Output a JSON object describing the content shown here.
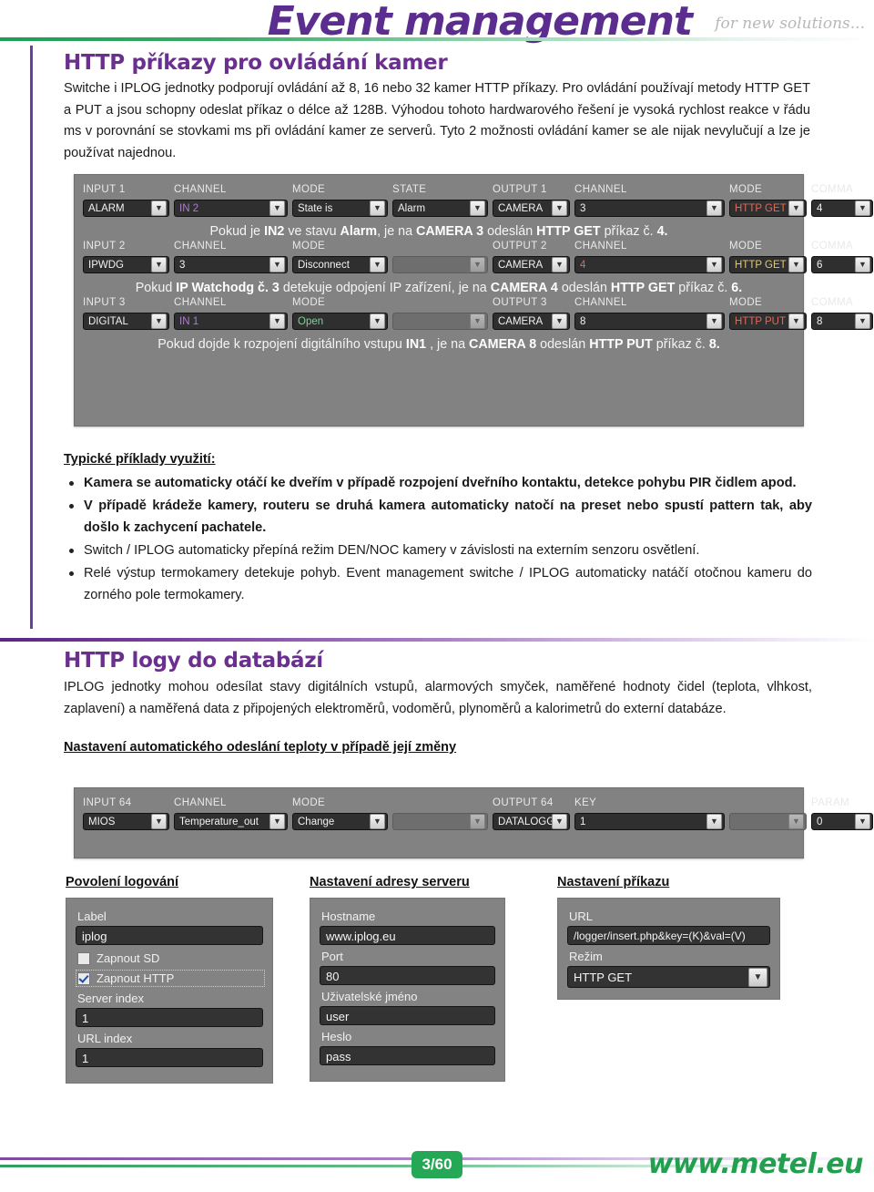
{
  "header": {
    "title": "Event management",
    "tagline": "for new solutions..."
  },
  "section1": {
    "heading": "HTTP příkazy pro ovládání kamer",
    "paragraph": "Switche i IPLOG jednotky podporují ovládání až 8, 16 nebo 32 kamer HTTP příkazy. Pro ovládání používají metody HTTP GET a PUT a jsou schopny odeslat příkaz o délce až 128B. Výhodou tohoto hardwarového řešení je vysoká rychlost reakce v řádu ms v porovnání se stovkami ms při ovládání kamer ze serverů. Tyto 2 možnosti ovládání kamer se ale nijak nevylučují a lze je používat najednou."
  },
  "config_panel": {
    "rows": [
      {
        "labels": [
          "INPUT 1",
          "CHANNEL",
          "MODE",
          "STATE",
          "OUTPUT 1",
          "CHANNEL",
          "MODE",
          "COMMA"
        ],
        "values": [
          "ALARM",
          "IN 2",
          "State is",
          "Alarm",
          "CAMERA",
          "3",
          "HTTP GET CMD",
          "4"
        ],
        "value_colors": [
          "#f2f2f2",
          "#b07ad6",
          "#f2f2f2",
          "#f2f2f2",
          "#f2f2f2",
          "#f2f2f2",
          "#e06a5a",
          "#f2f2f2"
        ],
        "caption_parts": [
          {
            "t": "Pokud je ",
            "b": false
          },
          {
            "t": "IN2",
            "b": true
          },
          {
            "t": " ve stavu ",
            "b": false
          },
          {
            "t": "Alarm",
            "b": true
          },
          {
            "t": ", je na ",
            "b": false
          },
          {
            "t": "CAMERA 3",
            "b": true
          },
          {
            "t": " odeslán ",
            "b": false
          },
          {
            "t": "HTTP GET",
            "b": true
          },
          {
            "t": " příkaz č. ",
            "b": false
          },
          {
            "t": "4.",
            "b": true
          }
        ]
      },
      {
        "labels": [
          "INPUT 2",
          "CHANNEL",
          "MODE",
          "",
          "OUTPUT 2",
          "CHANNEL",
          "MODE",
          "COMMA"
        ],
        "values": [
          "IPWDG",
          "3",
          "Disconnect",
          "",
          "CAMERA",
          "4",
          "HTTP GET CMD",
          "6"
        ],
        "value_colors": [
          "#f2f2f2",
          "#f2f2f2",
          "#f2f2f2",
          "#f2f2f2",
          "#f2f2f2",
          "#e06a5a",
          "#e0c878",
          "#f2f2f2"
        ],
        "caption_parts": [
          {
            "t": "Pokud ",
            "b": false
          },
          {
            "t": "IP Watchodg č. 3",
            "b": true
          },
          {
            "t": " detekuje odpojení IP zařízení, je na ",
            "b": false
          },
          {
            "t": "CAMERA 4",
            "b": true
          },
          {
            "t": " odeslán ",
            "b": false
          },
          {
            "t": "HTTP GET",
            "b": true
          },
          {
            "t": " příkaz č. ",
            "b": false
          },
          {
            "t": "6.",
            "b": true
          }
        ]
      },
      {
        "labels": [
          "INPUT 3",
          "CHANNEL",
          "MODE",
          "",
          "OUTPUT 3",
          "CHANNEL",
          "MODE",
          "COMMA"
        ],
        "values": [
          "DIGITAL",
          "IN 1",
          "Open",
          "",
          "CAMERA",
          "8",
          "HTTP PUT CMD",
          "8"
        ],
        "value_colors": [
          "#f2f2f2",
          "#b07ad6",
          "#7fcf9b",
          "#f2f2f2",
          "#f2f2f2",
          "#f2f2f2",
          "#e06a5a",
          "#f2f2f2"
        ],
        "caption_parts": [
          {
            "t": "Pokud dojde k rozpojení digitálního vstupu ",
            "b": false
          },
          {
            "t": "IN1",
            "b": true
          },
          {
            "t": " , je na ",
            "b": false
          },
          {
            "t": "CAMERA 8",
            "b": true
          },
          {
            "t": " odeslán ",
            "b": false
          },
          {
            "t": "HTTP PUT",
            "b": true
          },
          {
            "t": " příkaz č. ",
            "b": false
          },
          {
            "t": "8.",
            "b": true
          }
        ]
      }
    ]
  },
  "examples": {
    "heading": "Typické příklady využití:",
    "items": [
      "Kamera se automaticky otáčí ke dveřím v případě rozpojení dveřního kontaktu, detekce pohybu PIR čidlem apod.",
      "V případě krádeže kamery, routeru se druhá kamera automaticky natočí na preset nebo spustí pattern tak, aby došlo k zachycení pachatele.",
      "Switch / IPLOG automaticky přepíná režim DEN/NOC kamery v závislosti na externím senzoru osvětlení.",
      "Relé výstup termokamery detekuje pohyb. Event management switche / IPLOG automaticky natáčí otočnou kameru do zorného pole termokamery."
    ]
  },
  "section2": {
    "heading": "HTTP logy do databází",
    "paragraph": "IPLOG jednotky mohou odesílat stavy digitálních vstupů, alarmových smyček, naměřené hodnoty čidel (teplota, vlhkost, zaplavení) a naměřená data z připojených elektroměrů, vodoměrů, plynoměrů a kalorimetrů do externí databáze.",
    "subheading": "Nastavení automatického odeslání teploty v případě její změny"
  },
  "mios_panel": {
    "labels": [
      "INPUT 64",
      "CHANNEL",
      "MODE",
      "",
      "OUTPUT 64",
      "KEY",
      "",
      "PARAM"
    ],
    "values": [
      "MIOS",
      "Temperature_out",
      "Change",
      "",
      "DATALOGGER",
      "1",
      "",
      "0"
    ]
  },
  "forms": {
    "logging": {
      "title": "Povolení logování",
      "label_label": "Label",
      "label_value": "iplog",
      "sd_checkbox_label": "Zapnout SD",
      "sd_checked": false,
      "http_checkbox_label": "Zapnout HTTP",
      "http_checked": true,
      "server_index_label": "Server index",
      "server_index_value": "1",
      "url_index_label": "URL index",
      "url_index_value": "1"
    },
    "server": {
      "title": "Nastavení adresy serveru",
      "hostname_label": "Hostname",
      "hostname_value": "www.iplog.eu",
      "port_label": "Port",
      "port_value": "80",
      "user_label": "Uživatelské jméno",
      "user_value": "user",
      "password_label": "Heslo",
      "password_value": "pass"
    },
    "command": {
      "title": "Nastavení příkazu",
      "url_label": "URL",
      "url_value": "/logger/insert.php&key=(K)&val=(V)",
      "mode_label": "Režim",
      "mode_value": "HTTP GET"
    }
  },
  "footer": {
    "page": "3/60",
    "url": "www.metel.eu"
  },
  "colors": {
    "purple": "#5b2d8e",
    "green": "#22a04f",
    "panel_gray": "#828282",
    "field_dark": "#2f2f2f"
  }
}
